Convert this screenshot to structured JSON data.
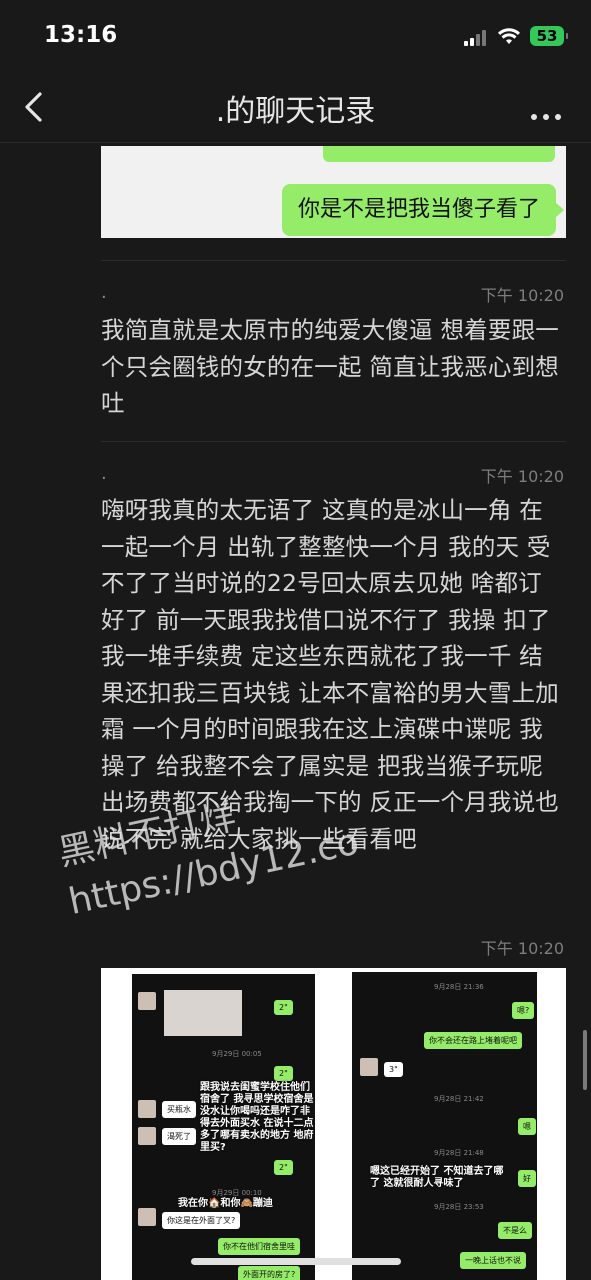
{
  "status": {
    "time": "13:16",
    "battery": "53"
  },
  "nav": {
    "title": ".的聊天记录"
  },
  "card": {
    "bubble": "你是不是把我当傻子看了"
  },
  "messages": [
    {
      "sender": ".",
      "time": "下午 10:20",
      "text": "我简直就是太原市的纯爱大傻逼 想着要跟一个只会圈钱的女的在一起 简直让我恶心到想吐"
    },
    {
      "sender": ".",
      "time": "下午 10:20",
      "text": "嗨呀我真的太无语了 这真的是冰山一角 在一起一个月 出轨了整整快一个月 我的天 受不了了当时说的22号回太原去见她 啥都订好了 前一天跟我找借口说不行了 我操 扣了我一堆手续费 定这些东西就花了我一千 结果还扣我三百块钱 让本不富裕的男大雪上加霜 一个月的时间跟我在这上演碟中谍呢 我操了 给我整不会了属实是 把我当猴子玩呢 出场费都不给我掏一下的 反正一个月我说也说不完 就给大家挑一些看看吧"
    },
    {
      "sender": "",
      "time": "下午 10:20",
      "text": ""
    }
  ],
  "watermark": {
    "line1": "黑料不打烊",
    "line2": "https://bdy12.co"
  },
  "screenshot_left": {
    "voice1": "2\"",
    "date1": "9月29日 00:05",
    "overlay": "跟我说去闺蜜学校住他们宿舍了 我寻思学校宿舍是没水让你喝吗还是咋了非得去外面买水 在说十二点多了哪有卖水的地方 地府里买?",
    "msg1": "买瓶水",
    "msg2": "渴死了",
    "voice2": "2\"",
    "date2": "9月29日 00:10",
    "overlay2": "我在你🏠和你🙈蹦迪",
    "msg3": "你这是在外面了叉?",
    "msg4": "你不在他们宿舍里哇",
    "msg5": "外面开的房了?"
  },
  "screenshot_right": {
    "date1": "9月28日 21:36",
    "msg1": "嗯?",
    "msg2": "你不会还在路上堵着呢吧",
    "voice": "3\"",
    "date2": "9月28日 21:42",
    "msg3": "嗯",
    "date3": "9月28日 21:48",
    "overlay": "嗯这已经开始了 不知道去了哪了 这就很耐人寻味了",
    "msg4": "好",
    "date4": "9月28日 23:53",
    "msg5": "不是么",
    "msg6": "一晚上话也不说"
  }
}
